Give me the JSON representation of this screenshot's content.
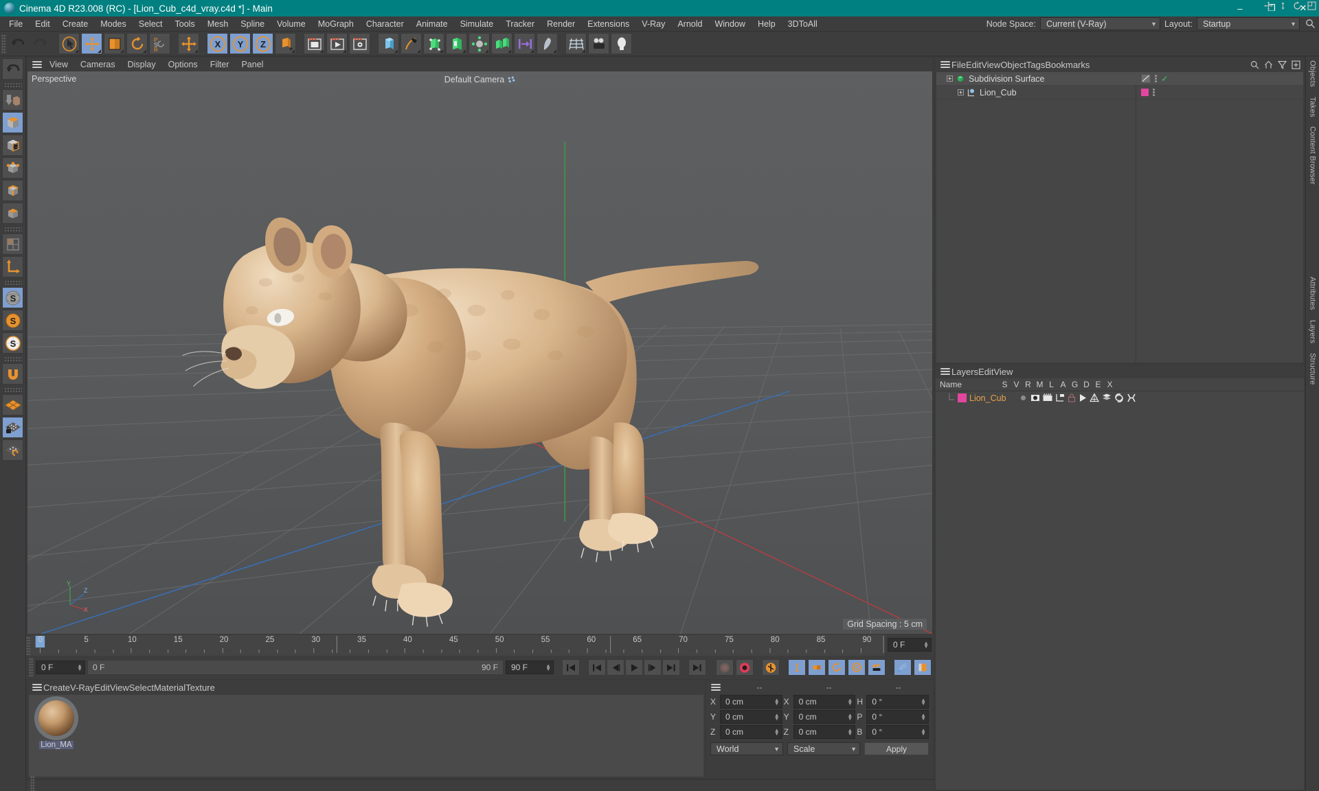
{
  "window": {
    "title": "Cinema 4D R23.008 (RC) - [Lion_Cub_c4d_vray.c4d *] - Main",
    "minimize": "–",
    "maximize": "❐",
    "close": "✕",
    "app_icon": "cinema4d-logo-icon",
    "titlebar_color": "#008080"
  },
  "menubar": {
    "items": [
      "File",
      "Edit",
      "Create",
      "Modes",
      "Select",
      "Tools",
      "Mesh",
      "Spline",
      "Volume",
      "MoGraph",
      "Character",
      "Animate",
      "Simulate",
      "Tracker",
      "Render",
      "Extensions",
      "V-Ray",
      "Arnold",
      "Window",
      "Help",
      "3DToAll"
    ],
    "node_space_label": "Node Space:",
    "node_space_value": "Current (V-Ray)",
    "layout_label": "Layout:",
    "layout_value": "Startup",
    "search_icon": "search-icon"
  },
  "toolbar": {
    "groups": [
      {
        "name": "history",
        "buttons": [
          {
            "name": "undo-button",
            "icon": "undo-arrow-icon",
            "active": false
          },
          {
            "name": "redo-button",
            "icon": "redo-arrow-icon",
            "active": false,
            "dim": true
          }
        ]
      },
      {
        "name": "tools",
        "buttons": [
          {
            "name": "live-selection-tool",
            "icon": "cursor-icon",
            "active": false
          },
          {
            "name": "move-tool",
            "icon": "move-axis-icon",
            "active": true
          },
          {
            "name": "scale-tool",
            "icon": "scale-box-icon",
            "active": false
          },
          {
            "name": "rotate-tool",
            "icon": "rotate-ring-icon",
            "active": false
          },
          {
            "name": "psr-tool",
            "icon": "psr-icon",
            "active": false
          }
        ]
      },
      {
        "name": "world-axis",
        "buttons": [
          {
            "name": "move-plus-tool",
            "icon": "plus-axis-icon",
            "active": false
          }
        ]
      },
      {
        "name": "axis-locks",
        "buttons": [
          {
            "name": "lock-x-axis",
            "icon": "x-axis-icon",
            "active": true
          },
          {
            "name": "lock-y-axis",
            "icon": "y-axis-icon",
            "active": true
          },
          {
            "name": "lock-z-axis",
            "icon": "z-axis-icon",
            "active": true
          },
          {
            "name": "world-object-toggle",
            "icon": "world-coord-icon",
            "active": false
          }
        ]
      },
      {
        "name": "render",
        "buttons": [
          {
            "name": "render-view-button",
            "icon": "render-view-icon",
            "active": false
          },
          {
            "name": "render-to-picture-viewer",
            "icon": "render-picture-icon",
            "active": false
          },
          {
            "name": "render-settings-button",
            "icon": "render-settings-gear-icon",
            "active": false
          }
        ]
      },
      {
        "name": "create",
        "buttons": [
          {
            "name": "add-cube-button",
            "icon": "cube-primitive-icon",
            "active": false
          },
          {
            "name": "add-spline-button",
            "icon": "pen-spline-icon",
            "active": false
          },
          {
            "name": "add-generator-button",
            "icon": "subdivision-generator-icon",
            "active": false
          },
          {
            "name": "add-nurbs-button",
            "icon": "nurbs-icon",
            "active": false
          },
          {
            "name": "add-deformer-button",
            "icon": "deformer-icon",
            "active": false
          },
          {
            "name": "add-scene-button",
            "icon": "scene-icon",
            "active": false
          },
          {
            "name": "add-mograph-button",
            "icon": "mograph-icon",
            "active": false
          },
          {
            "name": "add-field-button",
            "icon": "field-icon",
            "active": false
          },
          {
            "name": "add-camera-button",
            "icon": "camera-grid-icon",
            "active": false
          },
          {
            "name": "add-camera2-button",
            "icon": "camera-icon",
            "active": false
          },
          {
            "name": "add-light-button",
            "icon": "light-bulb-icon",
            "active": false
          }
        ]
      }
    ]
  },
  "leftbar": {
    "buttons": [
      {
        "name": "undo-left-button",
        "icon": "undo-arrow-icon",
        "active": false
      },
      {
        "name": "model-mode-button",
        "icon": "model-mode-icon",
        "active": false
      },
      {
        "name": "object-mode-button",
        "icon": "object-mode-cube-icon",
        "active": true
      },
      {
        "name": "texture-mode-button",
        "icon": "texture-checker-icon",
        "active": false
      },
      {
        "name": "points-mode-button",
        "icon": "points-mode-icon",
        "active": false
      },
      {
        "name": "edges-mode-button",
        "icon": "edges-mode-icon",
        "active": false
      },
      {
        "name": "polygons-mode-button",
        "icon": "polygons-mode-icon",
        "active": false
      },
      {
        "name": "uv-mode-button",
        "icon": "uv-grid-icon",
        "active": false
      },
      {
        "name": "axis-mode-button",
        "icon": "axis-corner-icon",
        "active": false
      },
      {
        "name": "enable-axis-button",
        "icon": "s-globe-grey-icon",
        "active": true
      },
      {
        "name": "enable-snap-button",
        "icon": "s-globe-orange-icon",
        "active": false
      },
      {
        "name": "viewport-solo-button",
        "icon": "s-globe-white-icon",
        "active": false
      },
      {
        "name": "magnet-tool-button",
        "icon": "magnet-icon",
        "active": false
      },
      {
        "name": "workplane-button",
        "icon": "orange-grid-icon",
        "active": false
      },
      {
        "name": "lock-workplane-button",
        "icon": "locked-grid-icon",
        "active": true
      },
      {
        "name": "planar-workplane-button",
        "icon": "rotate-grid-icon",
        "active": false
      }
    ]
  },
  "viewport": {
    "menu": [
      "View",
      "Cameras",
      "Display",
      "Options",
      "Filter",
      "Panel"
    ],
    "projection_label": "Perspective",
    "camera_label": "Default Camera",
    "grid_spacing_label": "Grid Spacing : 5 cm",
    "axis_gizmo": {
      "x": "X",
      "y": "Y",
      "z": "Z"
    },
    "nav_icons": [
      "pan-icon",
      "dolly-icon",
      "rotate-view-icon",
      "maximize-view-icon"
    ],
    "subject": "lion-cub-3d-model"
  },
  "timeline": {
    "ticks": [
      0,
      5,
      10,
      15,
      20,
      25,
      30,
      35,
      40,
      45,
      50,
      55,
      60,
      65,
      70,
      75,
      80,
      85,
      90
    ],
    "range_start": 0,
    "range_end": 90,
    "current_frame_field": "0 F",
    "current_frame_label": "0 F",
    "preview_min": "0 F",
    "preview_max": "90 F",
    "doc_end_field": "90 F",
    "playhead_frame": 0
  },
  "playback": {
    "buttons": [
      {
        "name": "go-to-start-button",
        "icon": "skip-start-icon"
      },
      {
        "name": "go-to-previous-key-button",
        "icon": "prev-key-icon"
      },
      {
        "name": "step-back-button",
        "icon": "step-back-icon"
      },
      {
        "name": "play-button",
        "icon": "play-icon"
      },
      {
        "name": "step-forward-button",
        "icon": "step-forward-icon"
      },
      {
        "name": "go-to-next-key-button",
        "icon": "next-key-icon"
      },
      {
        "name": "go-to-end-button",
        "icon": "skip-end-icon"
      },
      {
        "name": "record-active-objects-button",
        "icon": "record-grey-icon"
      },
      {
        "name": "autokeying-button",
        "icon": "autokey-red-icon"
      },
      {
        "name": "keyframe-selection-button",
        "icon": "keyframe-orange-icon"
      },
      {
        "name": "position-key-button",
        "icon": "position-key-icon",
        "active": true
      },
      {
        "name": "scale-key-button",
        "icon": "scale-key-icon",
        "active": true
      },
      {
        "name": "rotation-key-button",
        "icon": "rotation-key-icon",
        "active": true
      },
      {
        "name": "param-key-button",
        "icon": "param-key-icon",
        "active": true
      },
      {
        "name": "pla-key-button",
        "icon": "pla-key-icon",
        "active": true
      },
      {
        "name": "link-key-button",
        "icon": "link-key-icon",
        "active": true
      },
      {
        "name": "layout-key-button",
        "icon": "layout-key-icon",
        "active": true
      }
    ]
  },
  "material_manager": {
    "menu": [
      "Create",
      "V-Ray",
      "Edit",
      "View",
      "Select",
      "Material",
      "Texture"
    ],
    "materials": [
      {
        "name": "Lion_MA",
        "icon": "sphere-material-preview",
        "selected": true
      }
    ]
  },
  "coordinate_manager": {
    "header_cols": [
      "--",
      "--",
      "--"
    ],
    "rows": [
      {
        "pos_label": "X",
        "pos_value": "0 cm",
        "size_label": "X",
        "size_value": "0 cm",
        "rot_label": "H",
        "rot_value": "0 °"
      },
      {
        "pos_label": "Y",
        "pos_value": "0 cm",
        "size_label": "Y",
        "size_value": "0 cm",
        "rot_label": "P",
        "rot_value": "0 °"
      },
      {
        "pos_label": "Z",
        "pos_value": "0 cm",
        "size_label": "Z",
        "size_value": "0 cm",
        "rot_label": "B",
        "rot_value": "0 °"
      }
    ],
    "space_select": "World",
    "mode_select": "Scale",
    "apply_label": "Apply"
  },
  "object_manager": {
    "menu": [
      "File",
      "Edit",
      "View",
      "Object",
      "Tags",
      "Bookmarks"
    ],
    "tool_icons": [
      "search-icon",
      "home-icon",
      "filter-icon",
      "add-layer-icon"
    ],
    "items": [
      {
        "name": "Subdivision Surface",
        "indent": 0,
        "icon": "subdivision-surface-icon",
        "expander": "+",
        "tags": [
          "phong-tag"
        ],
        "check": "✓",
        "selected": true
      },
      {
        "name": "Lion_Cub",
        "indent": 1,
        "icon": "polygon-object-icon",
        "expander": "+",
        "tags": [
          "material-tag"
        ],
        "tag_color": "#e3469f",
        "selected": false
      }
    ]
  },
  "layer_manager": {
    "menu": [
      "Layers",
      "Edit",
      "View"
    ],
    "columns": [
      "Name",
      "S",
      "V",
      "R",
      "M",
      "L",
      "A",
      "G",
      "D",
      "E",
      "X"
    ],
    "rows": [
      {
        "name": "Lion_Cub",
        "color": "#e3469f",
        "icons": [
          "solo-dot-icon",
          "view-eye-icon",
          "render-film-icon",
          "manager-tree-icon",
          "lock-icon",
          "animation-play-icon",
          "generators-icon",
          "deformers-icon",
          "expressions-icon",
          "xref-icon"
        ]
      }
    ]
  },
  "right_dock": {
    "tabs": [
      "Objects",
      "Takes",
      "Content Browser",
      "Attributes",
      "Layers",
      "Structure"
    ]
  },
  "colors": {
    "accent_teal": "#008080",
    "active_blue": "#7e9fd0",
    "panel_bg": "#3d3d3d",
    "field_bg": "#2f2f2f",
    "viewport_bg": "#555759",
    "layer_pink": "#e3469f",
    "layer_text_orange": "#e8a34a"
  }
}
